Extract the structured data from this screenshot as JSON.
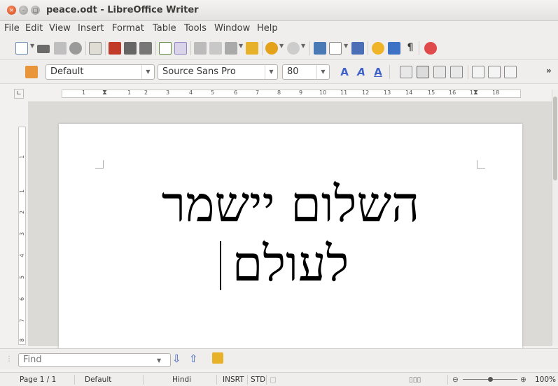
{
  "window": {
    "title": "peace.odt - LibreOffice Writer"
  },
  "menu": [
    "File",
    "Edit",
    "View",
    "Insert",
    "Format",
    "Table",
    "Tools",
    "Window",
    "Help"
  ],
  "formatting": {
    "style": "Default",
    "font": "Source Sans Pro",
    "size": "80"
  },
  "document": {
    "line1": "השלום יישמר",
    "line2": "לעולם"
  },
  "ruler": {
    "h_numbers": [
      "1",
      "1",
      "2",
      "3",
      "4",
      "5",
      "6",
      "7",
      "8",
      "9",
      "10",
      "11",
      "12",
      "13",
      "14",
      "15",
      "16",
      "17",
      "18"
    ],
    "v_numbers": [
      "1",
      "1",
      "2",
      "3",
      "4",
      "5",
      "6",
      "7",
      "8"
    ]
  },
  "find": {
    "placeholder": "Find"
  },
  "status": {
    "page": "Page 1 / 1",
    "style": "Default",
    "language": "Hindi",
    "insert_mode": "INSRT",
    "selection_mode": "STD",
    "zoom": "100%"
  },
  "colors": {
    "accent": "#e95420"
  }
}
